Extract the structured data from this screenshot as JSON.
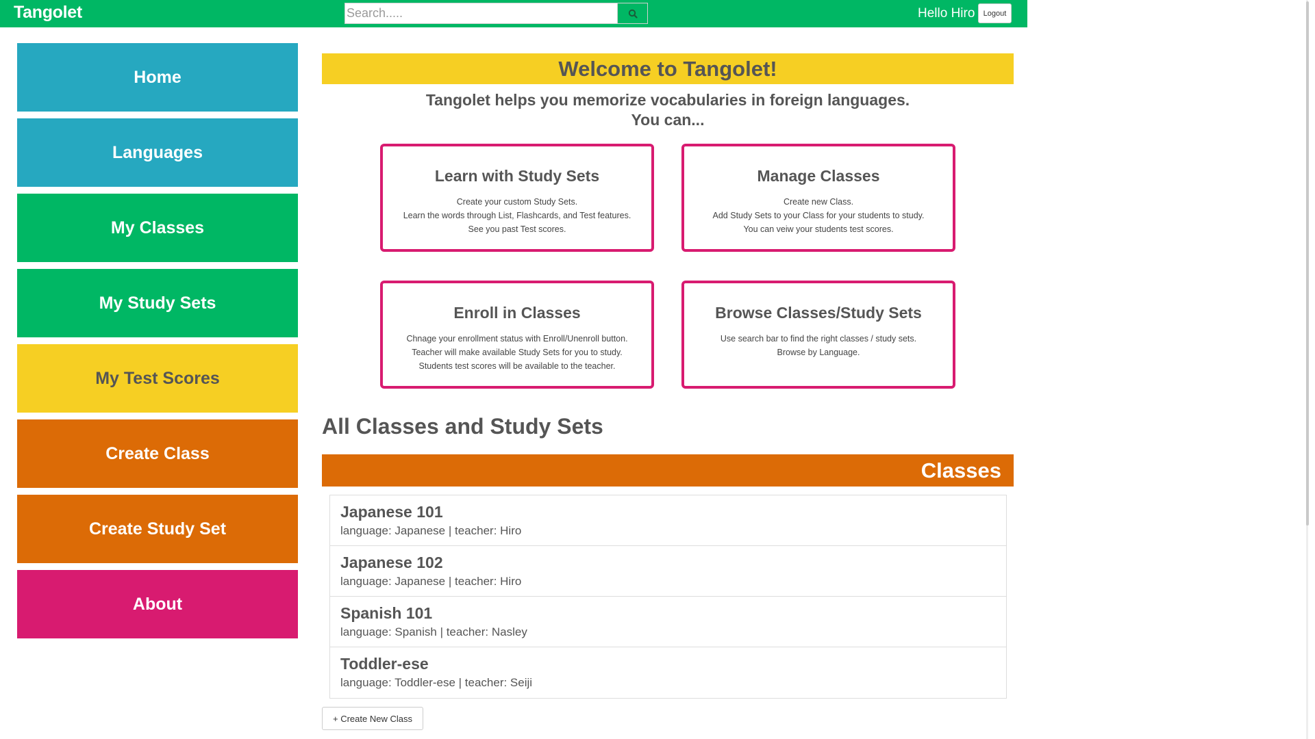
{
  "navbar": {
    "brand": "Tangolet",
    "search": {
      "placeholder": "Search.....",
      "icon": "search-icon"
    },
    "greeting": "Hello Hiro",
    "logout_label": "Logout",
    "color": "#00b764"
  },
  "sidebar": {
    "items": [
      {
        "label": "Home",
        "color": "#26a8c0"
      },
      {
        "label": "Languages",
        "color": "#26a8c0"
      },
      {
        "label": "My Classes",
        "color": "#00b764"
      },
      {
        "label": "My Study Sets",
        "color": "#00b764"
      },
      {
        "label": "My Test Scores",
        "color": "#f6cf23"
      },
      {
        "label": "Create Class",
        "color": "#dc6b06"
      },
      {
        "label": "Create Study Set",
        "color": "#dc6b06"
      },
      {
        "label": "About",
        "color": "#d81b70"
      }
    ]
  },
  "main": {
    "welcome": "Welcome to Tangolet!",
    "intro_line1": "Tangolet helps you memorize vocabularies in foreign languages.",
    "intro_line2": "You can...",
    "features": [
      {
        "title": "Learn with Study Sets",
        "lines": [
          "Create your custom Study Sets.",
          "Learn the words through List, Flashcards, and Test features.",
          "See you past Test scores."
        ]
      },
      {
        "title": "Manage Classes",
        "lines": [
          "Create new Class.",
          "Add Study Sets to your Class for your students to study.",
          "You can veiw your students test scores."
        ]
      },
      {
        "title": "Enroll in Classes",
        "lines": [
          "Chnage your enrollment status with Enroll/Unenroll button.",
          "Teacher will make available Study Sets for you to study.",
          "Students test scores will be available to the teacher."
        ]
      },
      {
        "title": "Browse Classes/Study Sets",
        "lines": [
          "Use search bar to find the right classes / study sets.",
          "Browse by Language."
        ]
      }
    ],
    "section_heading": "All Classes and Study Sets",
    "classes_header": "Classes",
    "classes": [
      {
        "name": "Japanese 101",
        "meta": "language: Japanese | teacher: Hiro"
      },
      {
        "name": "Japanese 102",
        "meta": "language: Japanese | teacher: Hiro"
      },
      {
        "name": "Spanish 101",
        "meta": "language: Spanish | teacher: Nasley"
      },
      {
        "name": "Toddler-ese",
        "meta": "language: Toddler-ese | teacher: Seiji"
      }
    ],
    "create_class_label": "+ Create New Class"
  }
}
